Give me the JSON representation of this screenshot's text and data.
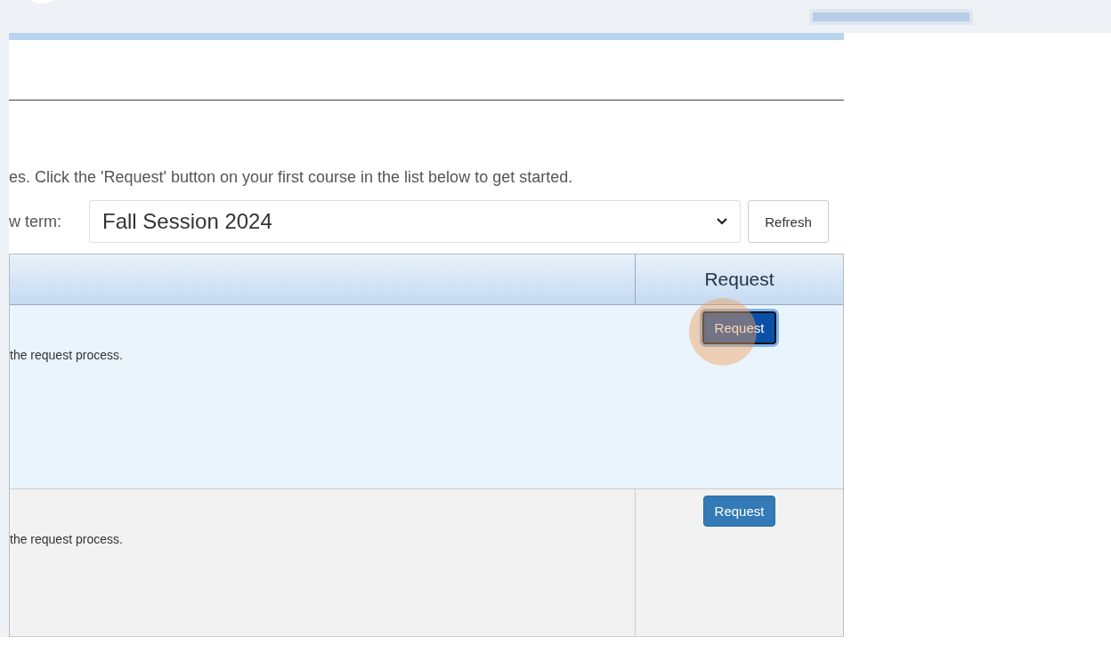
{
  "intro": "es. Click the 'Request' button on your first course in the list below to get started.",
  "term": {
    "label": "w term:",
    "value": "Fall Session 2024",
    "refresh": "Refresh"
  },
  "table": {
    "columns": [
      "Request"
    ],
    "rows": [
      {
        "text": "the request process.",
        "button": "Request",
        "focused": true,
        "highlighted": true
      },
      {
        "text": "the request process.",
        "button": "Request",
        "focused": false,
        "highlighted": false
      }
    ]
  }
}
